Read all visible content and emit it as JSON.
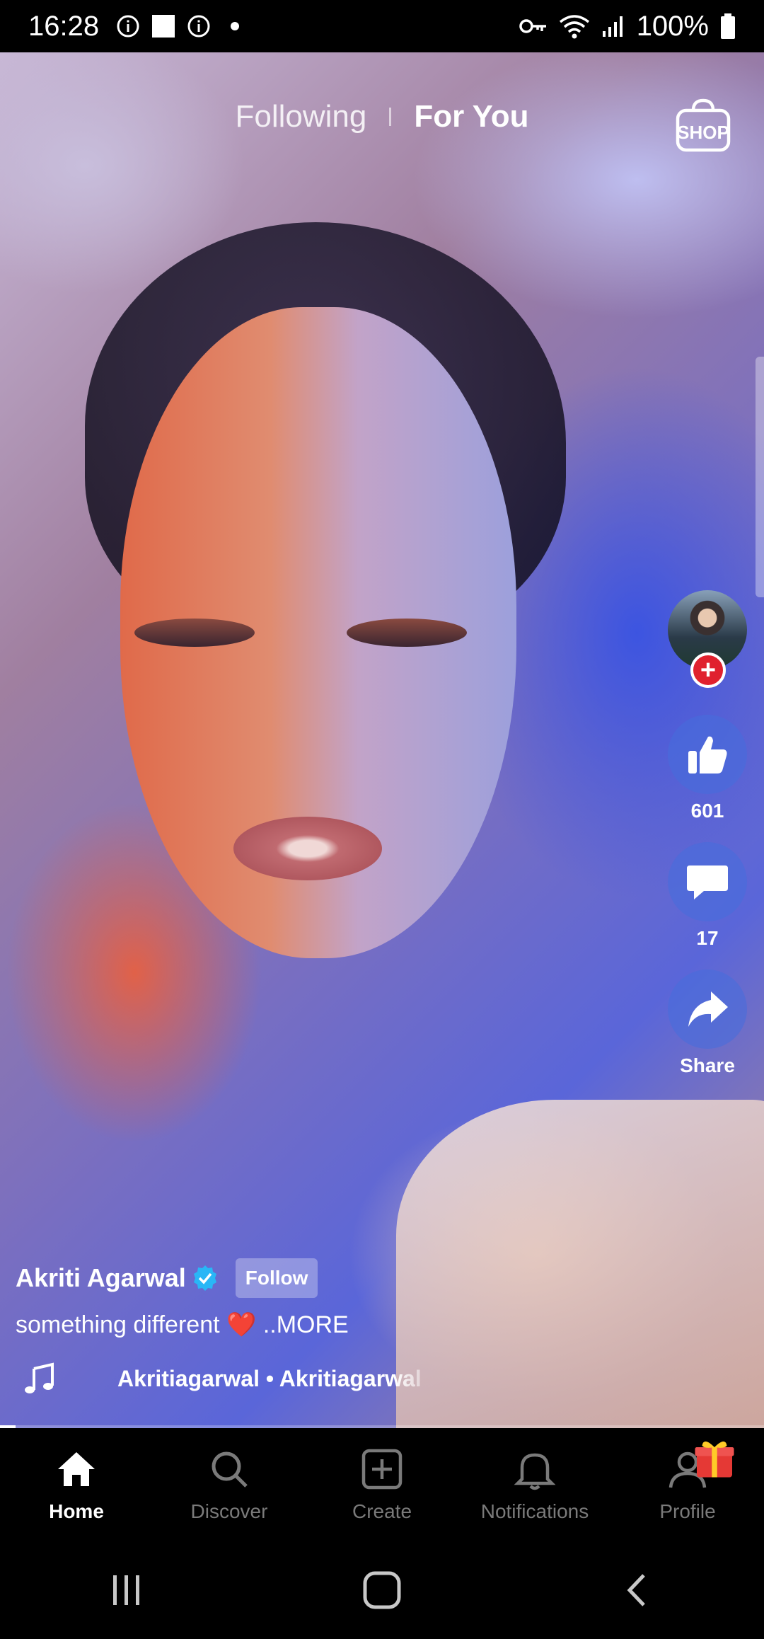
{
  "status_bar": {
    "time": "16:28",
    "battery": "100%"
  },
  "top_tabs": {
    "following": "Following",
    "for_you": "For You",
    "shop": "SHOP"
  },
  "rail": {
    "likes": "601",
    "comments": "17",
    "share": "Share"
  },
  "caption": {
    "author": "Akriti Agarwal",
    "follow": "Follow",
    "text": "something different",
    "heart": "❤️",
    "more": "..MORE",
    "music": "Akritiagarwal • Akritiagarwal"
  },
  "video_progress_percent": 2,
  "bottom_nav": {
    "home": "Home",
    "discover": "Discover",
    "create": "Create",
    "notifications": "Notifications",
    "profile": "Profile"
  },
  "icons": [
    "info-icon",
    "square-icon",
    "key-icon",
    "wifi-icon",
    "signal-icon",
    "battery-icon",
    "shop-bag-icon",
    "thumbs-up-icon",
    "comment-icon",
    "share-icon",
    "verified-icon",
    "music-note-icon",
    "home-icon",
    "search-icon",
    "create-icon",
    "bell-icon",
    "profile-icon",
    "gift-icon"
  ]
}
